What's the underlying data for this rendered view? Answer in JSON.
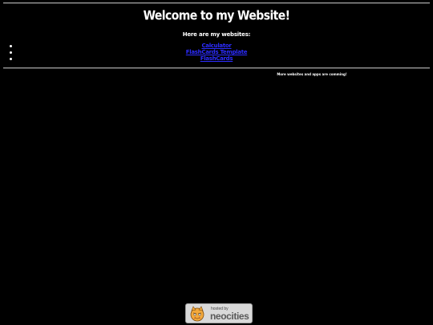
{
  "header": {
    "title": "Welcome to my Website!",
    "subtitle": "Here are my websites:"
  },
  "websites": [
    {
      "label": "Calculator"
    },
    {
      "label": "FlashCards Template"
    },
    {
      "label": "FlashCards"
    }
  ],
  "notice": {
    "text": "More websites and apps are comming!"
  },
  "badge": {
    "hosted_label": "hosted by",
    "brand_label": "neocities"
  },
  "colors": {
    "background": "#000000",
    "text": "#ffffff",
    "link": "#2c2cff"
  }
}
